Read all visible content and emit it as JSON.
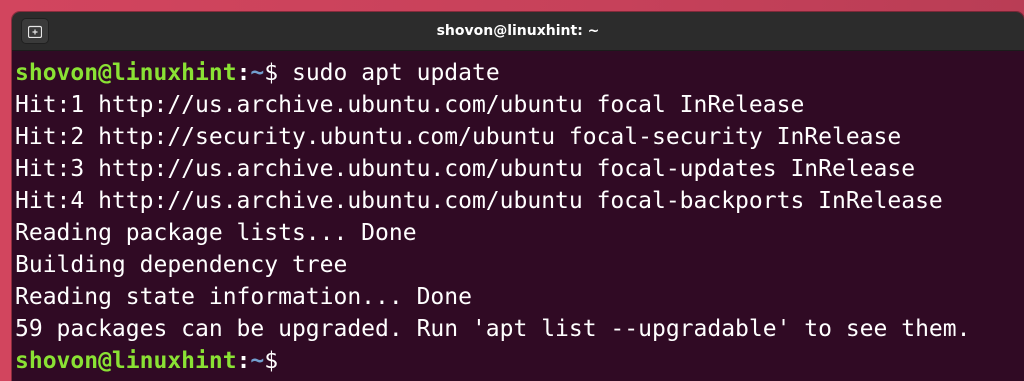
{
  "window": {
    "title": "shovon@linuxhint: ~"
  },
  "icons": {
    "new_tab": "new-tab-icon"
  },
  "colors": {
    "prompt_user": "#8ae234",
    "prompt_path": "#729fcf",
    "terminal_bg": "#300a24",
    "titlebar_bg": "#2c2c2c"
  },
  "terminal": {
    "prompt1": {
      "user": "shovon@linuxhint",
      "colon": ":",
      "path": "~",
      "dollar": "$",
      "command": " sudo apt update"
    },
    "output": [
      "Hit:1 http://us.archive.ubuntu.com/ubuntu focal InRelease",
      "Hit:2 http://security.ubuntu.com/ubuntu focal-security InRelease",
      "Hit:3 http://us.archive.ubuntu.com/ubuntu focal-updates InRelease",
      "Hit:4 http://us.archive.ubuntu.com/ubuntu focal-backports InRelease",
      "Reading package lists... Done",
      "Building dependency tree",
      "Reading state information... Done",
      "59 packages can be upgraded. Run 'apt list --upgradable' to see them."
    ],
    "prompt2": {
      "user": "shovon@linuxhint",
      "colon": ":",
      "path": "~",
      "dollar": "$"
    }
  }
}
